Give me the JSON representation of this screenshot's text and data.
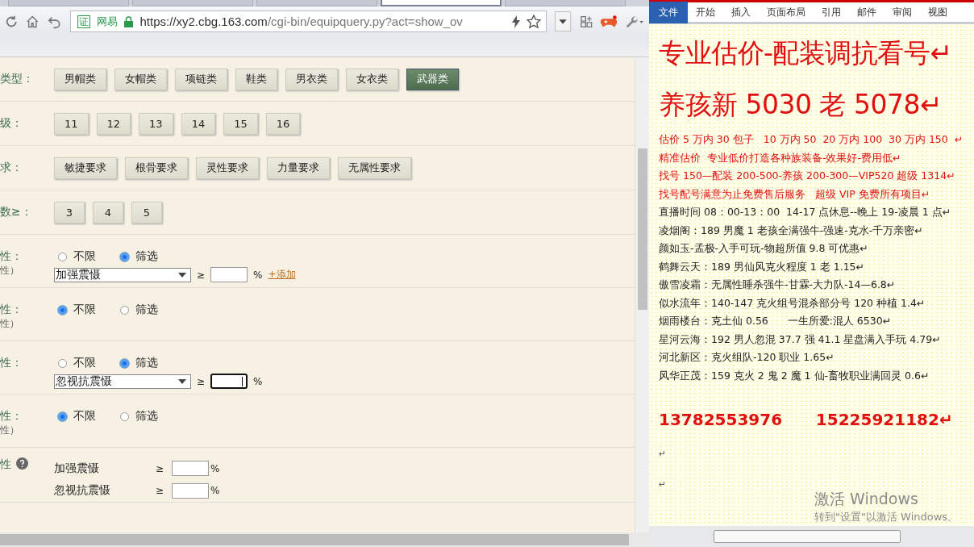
{
  "browser": {
    "tabs": [
      {
        "selected": false
      },
      {
        "selected": false
      },
      {
        "selected": false
      },
      {
        "selected": true
      },
      {
        "selected": false
      }
    ],
    "address": {
      "badge": "证",
      "site": "网易",
      "url_host": "https://xy2.cbg.163.com",
      "url_path": "/cgi-bin/equipquery.py?act=show_ov"
    }
  },
  "filters": [
    {
      "label": "类型：",
      "options": [
        {
          "label": "男帽类",
          "selected": false
        },
        {
          "label": "女帽类",
          "selected": false
        },
        {
          "label": "项链类",
          "selected": false
        },
        {
          "label": "鞋类",
          "selected": false
        },
        {
          "label": "男衣类",
          "selected": false
        },
        {
          "label": "女衣类",
          "selected": false
        },
        {
          "label": "武器类",
          "selected": true
        }
      ]
    },
    {
      "label": "级：",
      "options": [
        {
          "label": "11",
          "selected": false
        },
        {
          "label": "12",
          "selected": false
        },
        {
          "label": "13",
          "selected": false
        },
        {
          "label": "14",
          "selected": false
        },
        {
          "label": "15",
          "selected": false
        },
        {
          "label": "16",
          "selected": false
        }
      ]
    },
    {
      "label": "求：",
      "options": [
        {
          "label": "敏捷要求",
          "selected": false
        },
        {
          "label": "根骨要求",
          "selected": false
        },
        {
          "label": "灵性要求",
          "selected": false
        },
        {
          "label": "力量要求",
          "selected": false
        },
        {
          "label": "无属性要求",
          "selected": false
        }
      ]
    },
    {
      "label": "数≥：",
      "options": [
        {
          "label": "3",
          "selected": false
        },
        {
          "label": "4",
          "selected": false
        },
        {
          "label": "5",
          "selected": false
        }
      ]
    }
  ],
  "attributes": [
    {
      "label": "性：",
      "sublabel": "性）",
      "radios": [
        {
          "label": "不限",
          "selected": false
        },
        {
          "label": "筛选",
          "selected": true
        }
      ],
      "condition": {
        "select": "加强震慑",
        "sign": "≥",
        "unit": "%",
        "link": "+添加",
        "focused": false
      }
    },
    {
      "label": "性：",
      "sublabel": "性）",
      "radios": [
        {
          "label": "不限",
          "selected": true
        },
        {
          "label": "筛选",
          "selected": false
        }
      ]
    },
    {
      "label": "性：",
      "radios": [
        {
          "label": "不限",
          "selected": false
        },
        {
          "label": "筛选",
          "selected": true
        }
      ],
      "condition": {
        "select": "忽视抗震慑",
        "sign": "≥",
        "unit": "%",
        "focused": true
      }
    },
    {
      "label": "性：",
      "sublabel": "性）",
      "radios": [
        {
          "label": "不限",
          "selected": true
        },
        {
          "label": "筛选",
          "selected": false
        }
      ]
    }
  ],
  "summary": {
    "label": "性",
    "rows": [
      {
        "name": "加强震慑",
        "sign": "≥",
        "unit": "%"
      },
      {
        "name": "忽视抗震慑",
        "sign": "≥",
        "unit": "%"
      }
    ]
  },
  "word": {
    "tabs": [
      {
        "label": "文件",
        "selected": true
      },
      {
        "label": "开始",
        "selected": false
      },
      {
        "label": "插入",
        "selected": false
      },
      {
        "label": "页面布局",
        "selected": false
      },
      {
        "label": "引用",
        "selected": false
      },
      {
        "label": "邮件",
        "selected": false
      },
      {
        "label": "审阅",
        "selected": false
      },
      {
        "label": "视图",
        "selected": false
      }
    ],
    "paragraphs": [
      {
        "kind": "title",
        "text": "专业估价-配装调抗看号↵"
      },
      {
        "kind": "title",
        "text": "养孩新 5030 老 5078↵"
      },
      {
        "kind": "red",
        "text": "估价 5 万内 30 包子   10 万内 50  20 万内 100  30 万内 150  ↵"
      },
      {
        "kind": "red",
        "text": "精准估价  专业低价打造各种族装备-效果好-费用低↵"
      },
      {
        "kind": "red",
        "text": "找号 150—配装 200-500-养孩 200-300—VIP520 超级 1314↵"
      },
      {
        "kind": "red",
        "text": "找号配号满意为止免费售后服务   超级 VIP 免费所有项目↵"
      },
      {
        "kind": "black",
        "text": "直播时间 08：00-13：00  14-17 点休息--晚上 19-凌晨 1 点↵"
      },
      {
        "kind": "black",
        "text": "凌烟阁：189 男魔 1 老孩全满强牛-强速-克水-千万亲密↵"
      },
      {
        "kind": "black",
        "text": "颜如玉-孟极-入手可玩-物超所值 9.8 可优惠↵"
      },
      {
        "kind": "black",
        "text": "鹤舞云天：189 男仙风克火程度 1 老 1.15↵"
      },
      {
        "kind": "black",
        "text": "傲雪凌霜：无属性睡杀强牛-甘霖-大力队-14—6.8↵"
      },
      {
        "kind": "black",
        "text": "似水流年：140-147 克火组号混杀部分号 120 种植 1.4↵"
      },
      {
        "kind": "black",
        "text": "烟雨楼台：克土仙 0.56      一生所爱:混人 6530↵"
      },
      {
        "kind": "black",
        "text": "星河云海：192 男人忽混 37.7 强 41.1 星盘满入手玩 4.79↵"
      },
      {
        "kind": "black",
        "text": "河北新区：克火组队-120 职业 1.65↵"
      },
      {
        "kind": "black",
        "text": "风华正茂：159 克火 2 鬼 2 魔 1 仙-畜牧职业满回灵 0.6↵"
      },
      {
        "kind": "phone",
        "text": "13782553976      15225921182↵"
      },
      {
        "kind": "empty",
        "text": "↵"
      },
      {
        "kind": "empty",
        "text": "↵"
      }
    ],
    "activation": [
      "激活 Windows",
      "转到\"设置\"以激活 Windows。"
    ]
  }
}
